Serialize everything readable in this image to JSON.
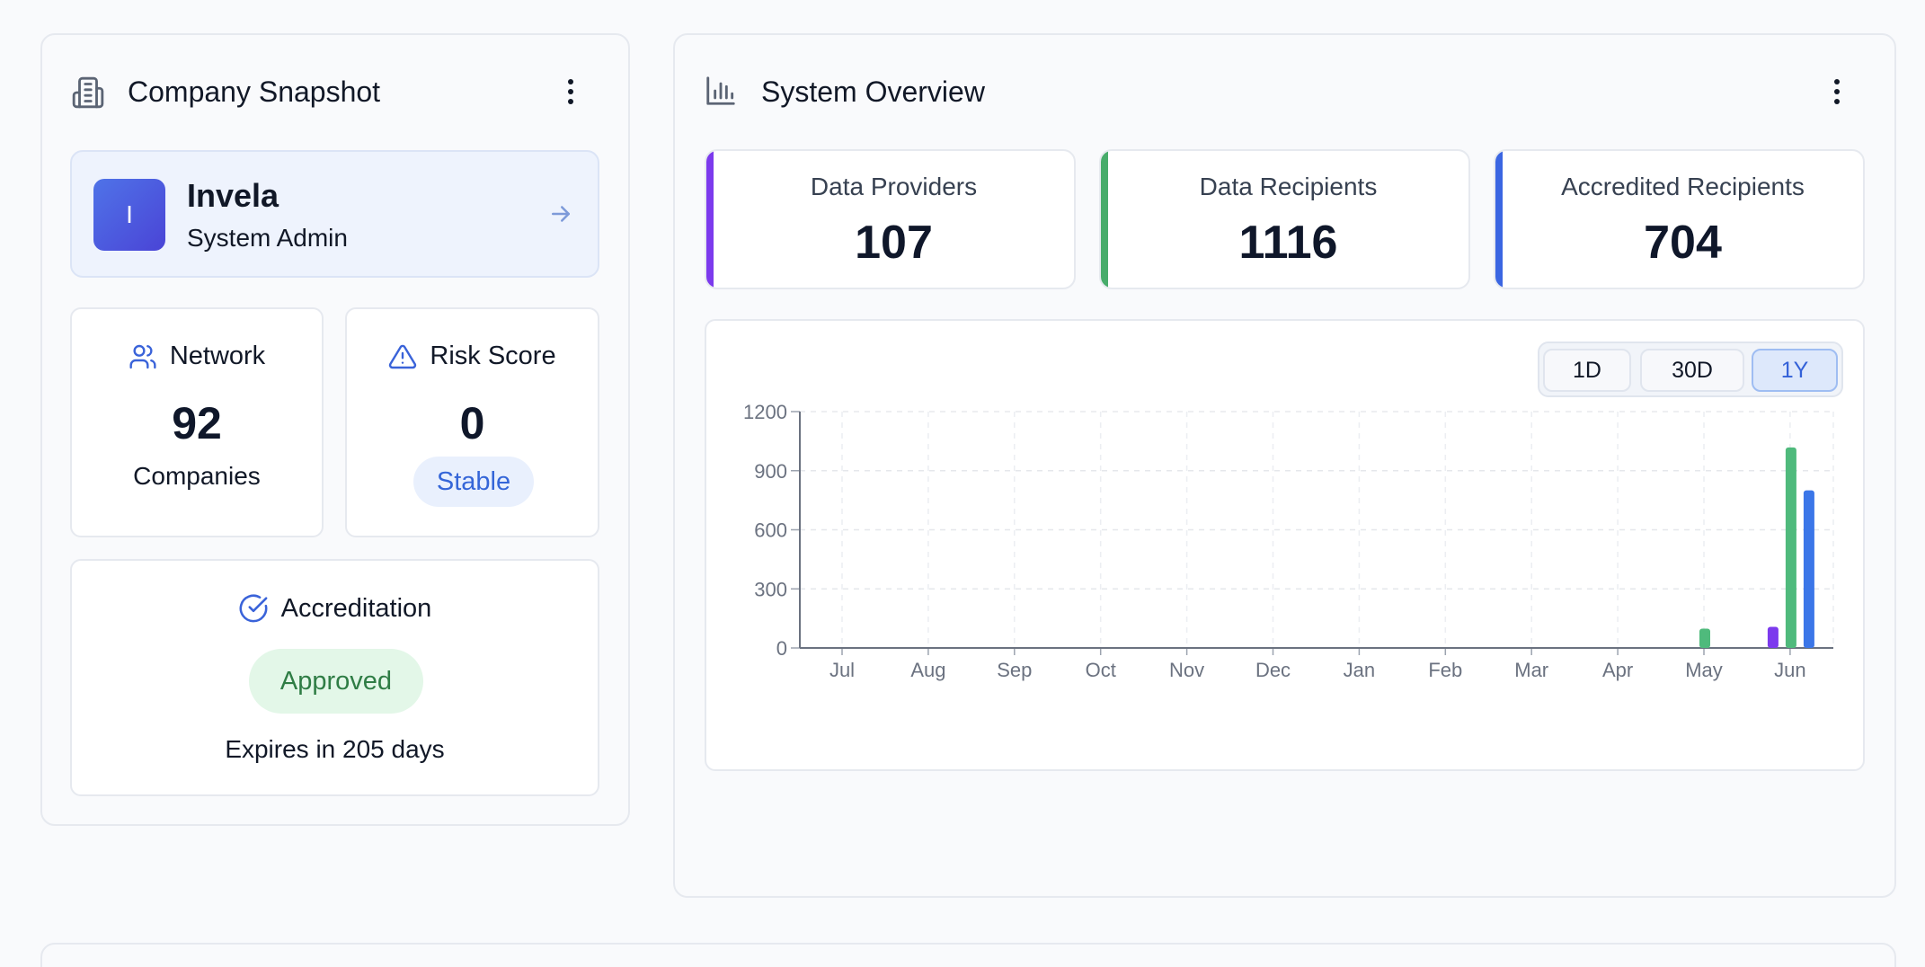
{
  "company_snapshot": {
    "title": "Company Snapshot",
    "company": {
      "initial": "I",
      "name": "Invela",
      "role": "System Admin"
    },
    "network": {
      "label": "Network",
      "value": "92",
      "sub": "Companies"
    },
    "risk": {
      "label": "Risk Score",
      "value": "0",
      "status": "Stable"
    },
    "accreditation": {
      "label": "Accreditation",
      "status": "Approved",
      "expires": "Expires in 205 days"
    }
  },
  "system_overview": {
    "title": "System Overview",
    "metrics": [
      {
        "label": "Data Providers",
        "value": "107",
        "color": "#7c3aed"
      },
      {
        "label": "Data Recipients",
        "value": "1116",
        "color": "#48ac6b"
      },
      {
        "label": "Accredited Recipients",
        "value": "704",
        "color": "#3b66e2"
      }
    ],
    "range_buttons": [
      "1D",
      "30D",
      "1Y"
    ],
    "active_range": "1Y"
  },
  "chart_data": {
    "type": "bar",
    "categories": [
      "Jul",
      "Aug",
      "Sep",
      "Oct",
      "Nov",
      "Dec",
      "Jan",
      "Feb",
      "Mar",
      "Apr",
      "May",
      "Jun"
    ],
    "series": [
      {
        "values": [
          0,
          0,
          0,
          0,
          0,
          0,
          0,
          0,
          0,
          0,
          0,
          107
        ],
        "color": "#7c3aed"
      },
      {
        "values": [
          0,
          0,
          0,
          0,
          0,
          0,
          0,
          0,
          0,
          0,
          98,
          1018
        ],
        "color": "#4fba7c"
      },
      {
        "values": [
          0,
          0,
          0,
          0,
          0,
          0,
          0,
          0,
          0,
          0,
          0,
          800
        ],
        "color": "#3b76e8"
      }
    ],
    "y_ticks": [
      "0",
      "300",
      "600",
      "900",
      "1200"
    ],
    "ylim": [
      0,
      1200
    ],
    "grid": true
  }
}
